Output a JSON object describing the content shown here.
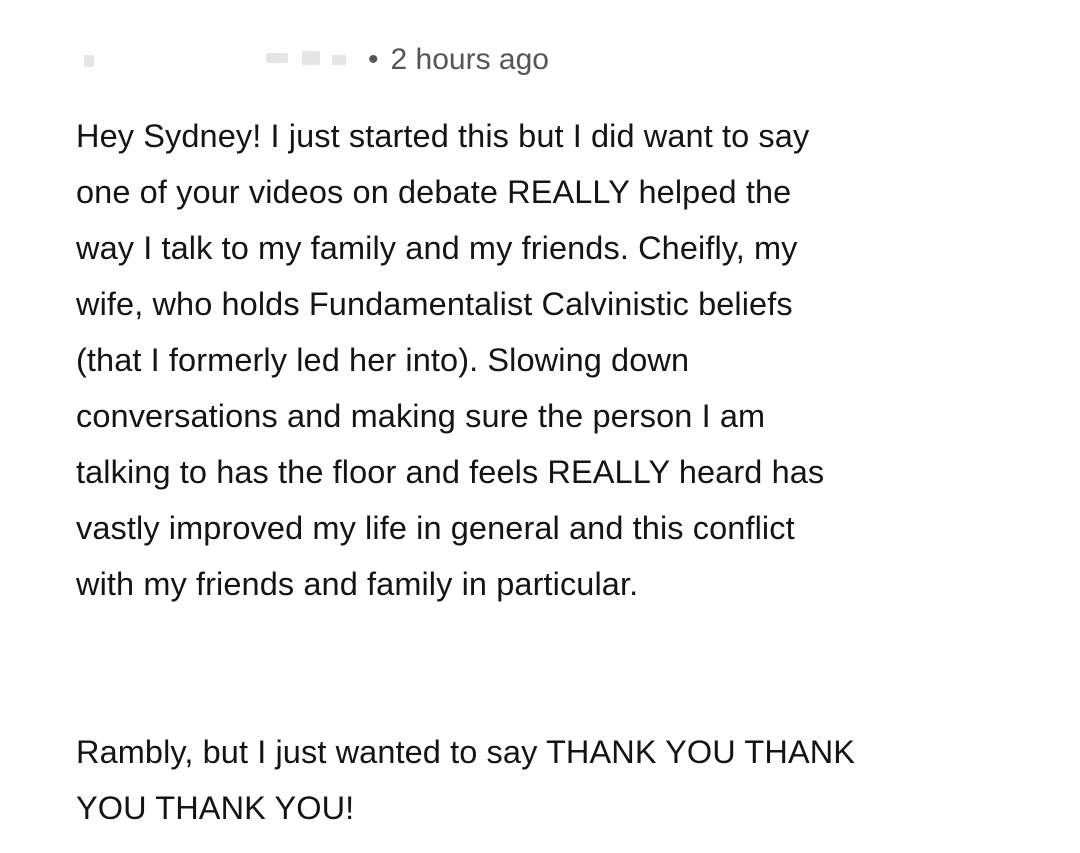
{
  "comment": {
    "meta": {
      "separator": "•",
      "timestamp": "2 hours ago"
    },
    "paragraphs": [
      [
        "Hey Sydney! I just started this but I did want to say",
        "one of your videos on debate REALLY helped the",
        "way I talk to my family and my friends. Cheifly, my",
        "wife, who holds Fundamentalist Calvinistic beliefs",
        "(that I formerly led her into). Slowing down",
        "conversations and making sure the person I am",
        "talking to has the floor and feels REALLY heard has",
        "vastly improved my life in general and this conflict",
        "with my friends and family in particular."
      ],
      [
        "Rambly, but I just wanted to say THANK YOU THANK",
        "YOU THANK YOU!"
      ]
    ]
  }
}
